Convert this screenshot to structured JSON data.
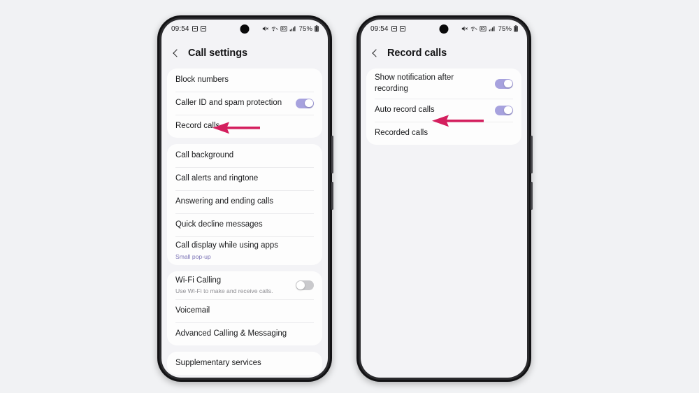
{
  "page": {
    "background_color": "#f1f2f4",
    "accent_toggle_on": "#a7a2de",
    "accent_toggle_off": "#c9c9cc",
    "annotation_arrow_color": "#d41f5e",
    "subtitle_color": "#7a72b5"
  },
  "phones": [
    {
      "id": "left-phone",
      "status_bar": {
        "time": "09:54",
        "icons_left": [
          "app-icon",
          "app-icon"
        ],
        "icons_right": [
          "mute-icon",
          "wifi-calling-icon",
          "nfc-icon",
          "signal-icon"
        ],
        "battery_level": "75%",
        "battery_icon": "battery-icon"
      },
      "header": {
        "back_icon": "back-chevron-icon",
        "title": "Call settings"
      },
      "groups": [
        {
          "rows": [
            {
              "title": "Block numbers",
              "subtitle": "",
              "toggle": null
            },
            {
              "title": "Caller ID and spam protection",
              "subtitle": "",
              "toggle": "on"
            },
            {
              "title": "Record calls",
              "subtitle": "",
              "toggle": null,
              "annotated": true
            }
          ]
        },
        {
          "rows": [
            {
              "title": "Call background",
              "subtitle": "",
              "toggle": null
            },
            {
              "title": "Call alerts and ringtone",
              "subtitle": "",
              "toggle": null
            },
            {
              "title": "Answering and ending calls",
              "subtitle": "",
              "toggle": null
            },
            {
              "title": "Quick decline messages",
              "subtitle": "",
              "toggle": null
            },
            {
              "title": "Call display while using apps",
              "subtitle": "Small pop-up",
              "toggle": null
            }
          ]
        },
        {
          "rows": [
            {
              "title": "Wi-Fi Calling",
              "subtitle": "Use Wi-Fi to make and receive calls.",
              "subtitle_gray": true,
              "toggle": "off"
            },
            {
              "title": "Voicemail",
              "subtitle": "",
              "toggle": null
            },
            {
              "title": "Advanced Calling & Messaging",
              "subtitle": "",
              "toggle": null
            }
          ]
        },
        {
          "rows": [
            {
              "title": "Supplementary services",
              "subtitle": "",
              "toggle": null
            }
          ]
        }
      ]
    },
    {
      "id": "right-phone",
      "status_bar": {
        "time": "09:54",
        "icons_left": [
          "app-icon",
          "app-icon"
        ],
        "icons_right": [
          "mute-icon",
          "wifi-calling-icon",
          "nfc-icon",
          "signal-icon"
        ],
        "battery_level": "75%",
        "battery_icon": "battery-icon"
      },
      "header": {
        "back_icon": "back-chevron-icon",
        "title": "Record calls"
      },
      "groups": [
        {
          "rows": [
            {
              "title": "Show notification after recording",
              "subtitle": "",
              "toggle": "on"
            },
            {
              "title": "Auto record calls",
              "subtitle": "",
              "toggle": "on"
            },
            {
              "title": "Recorded calls",
              "subtitle": "",
              "toggle": null,
              "annotated": true
            }
          ]
        }
      ]
    }
  ]
}
